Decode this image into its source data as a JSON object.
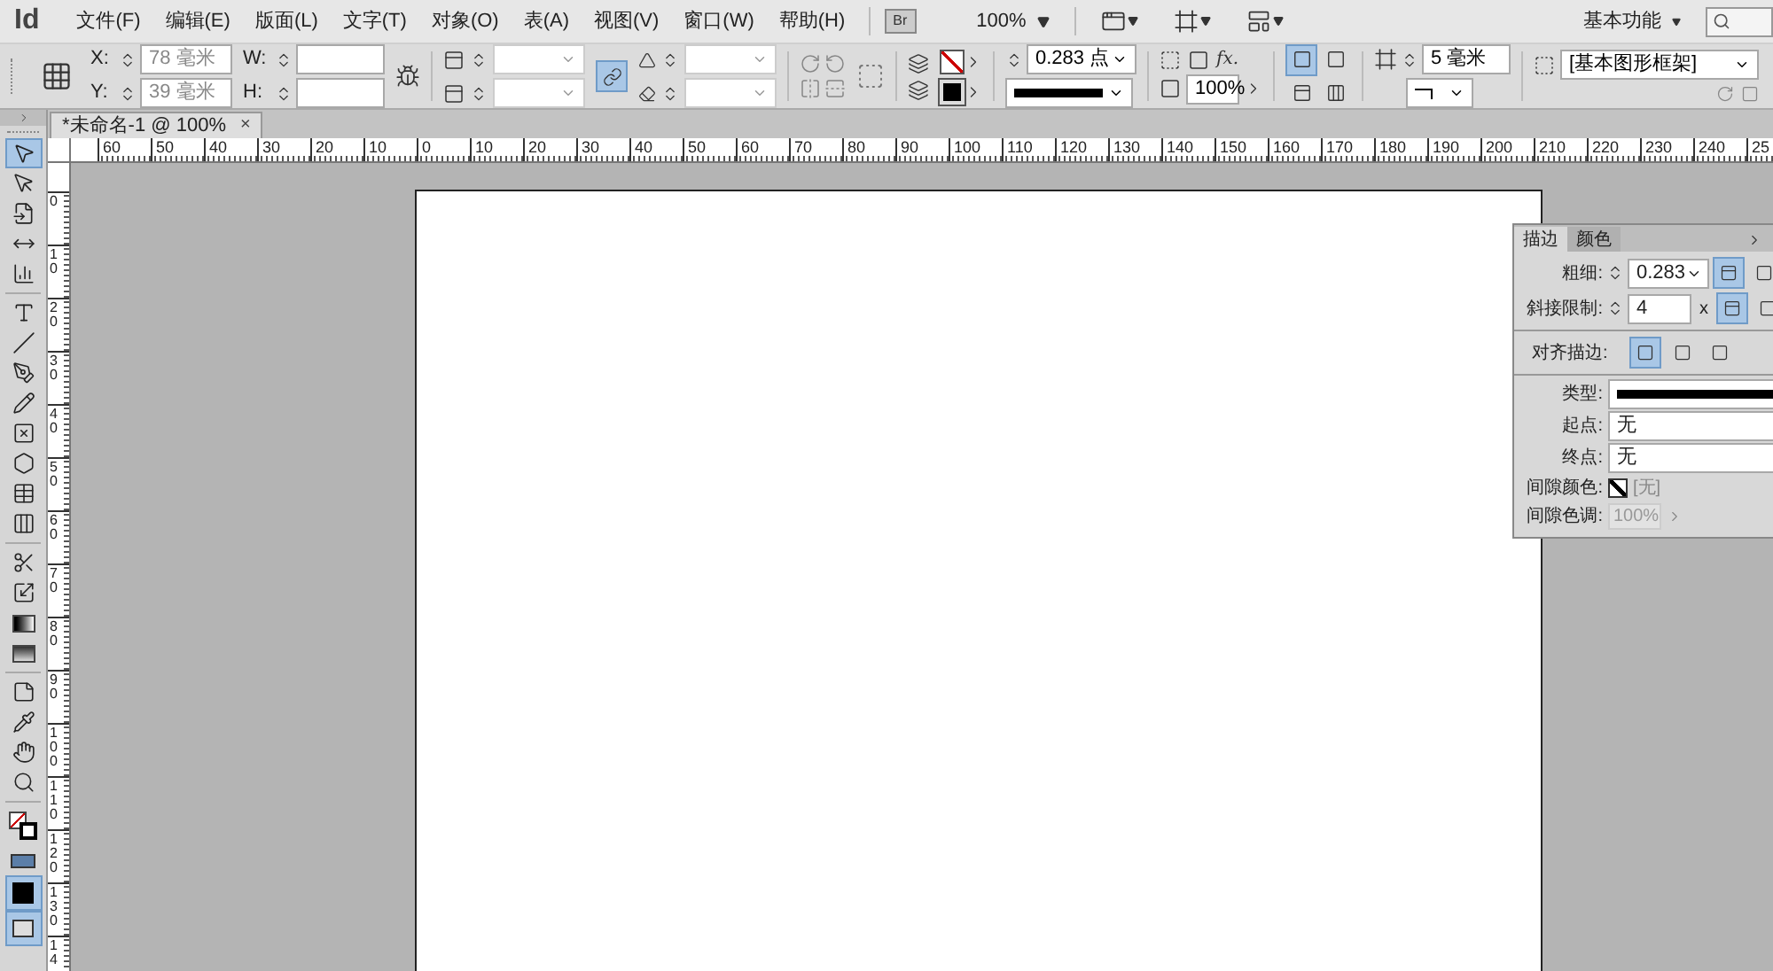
{
  "app": {
    "logo": "Id",
    "bridge_button": "Br",
    "zoom": "100%",
    "workspace": "基本功能"
  },
  "menu": [
    {
      "label": "文件(F)"
    },
    {
      "label": "编辑(E)"
    },
    {
      "label": "版面(L)"
    },
    {
      "label": "文字(T)"
    },
    {
      "label": "对象(O)"
    },
    {
      "label": "表(A)"
    },
    {
      "label": "视图(V)"
    },
    {
      "label": "窗口(W)"
    },
    {
      "label": "帮助(H)"
    }
  ],
  "control_panel": {
    "x_label": "X:",
    "x_value": "78 毫米",
    "y_label": "Y:",
    "y_value": "39 毫米",
    "w_label": "W:",
    "h_label": "H:",
    "constrain_on": true,
    "stroke_weight": "0.283 点",
    "opacity": "100%",
    "effects_label": "fx.",
    "corner_size": "5 毫米",
    "object_style": "[基本图形框架]",
    "wrap_buttons": [
      {
        "selected": true
      },
      {
        "selected": false
      }
    ]
  },
  "document_tab": {
    "title": "*未命名-1 @ 100%",
    "close": "×"
  },
  "horizontal_ruler": [
    "60",
    "50",
    "40",
    "30",
    "20",
    "10",
    "0",
    "10",
    "20",
    "30",
    "40",
    "50",
    "60",
    "70",
    "80",
    "90",
    "100",
    "110",
    "120",
    "130",
    "140",
    "150",
    "160",
    "170",
    "180",
    "190",
    "200",
    "210",
    "220",
    "230",
    "240",
    "25"
  ],
  "vertical_ruler": [
    "0",
    "10",
    "20",
    "30",
    "40",
    "50",
    "60",
    "70",
    "80",
    "90",
    "100",
    "110",
    "120",
    "130",
    "14"
  ],
  "tool_groups": [
    [
      {
        "kind": "selection",
        "selected": true
      },
      {
        "kind": "direct",
        "selected": false
      },
      {
        "kind": "page",
        "selected": false
      },
      {
        "kind": "gap",
        "selected": false
      },
      {
        "kind": "collector",
        "selected": false
      }
    ],
    [
      {
        "kind": "type",
        "selected": false
      },
      {
        "kind": "line",
        "selected": false
      },
      {
        "kind": "pen",
        "selected": false
      },
      {
        "kind": "pencil",
        "selected": false
      },
      {
        "kind": "frame",
        "selected": false
      },
      {
        "kind": "polygon",
        "selected": false
      },
      {
        "kind": "table",
        "selected": false
      },
      {
        "kind": "table2",
        "selected": false
      }
    ],
    [
      {
        "kind": "scissors",
        "selected": false
      },
      {
        "kind": "transform",
        "selected": false
      },
      {
        "kind": "gradient",
        "selected": false
      },
      {
        "kind": "feather",
        "selected": false
      }
    ],
    [
      {
        "kind": "note",
        "selected": false
      },
      {
        "kind": "eyedropper",
        "selected": false
      },
      {
        "kind": "hand",
        "selected": false
      },
      {
        "kind": "zoom",
        "selected": false
      }
    ],
    [
      {
        "kind": "fillstroke",
        "selected": false
      },
      {
        "kind": "format",
        "selected": false
      },
      {
        "kind": "mode",
        "selected": true
      },
      {
        "kind": "screen",
        "selected": true
      }
    ]
  ],
  "stroke_panel": {
    "tabs": [
      {
        "label": "描边",
        "selected": true
      },
      {
        "label": "颜色",
        "selected": false
      }
    ],
    "weight_label": "粗细:",
    "weight": "0.283",
    "miter_label": "斜接限制:",
    "miter": "4",
    "miter_unit": "x",
    "align_label": "对齐描边:",
    "align_options": [
      {
        "selected": true
      },
      {
        "selected": false
      },
      {
        "selected": false
      }
    ],
    "type_label": "类型:",
    "start_label": "起点:",
    "start": "无",
    "end_label": "终点:",
    "end": "无",
    "gap_color_label": "间隙颜色:",
    "gap_color": "[无]",
    "gap_tint_label": "间隙色调:",
    "gap_tint": "100%",
    "gap_tint_disabled": true
  }
}
